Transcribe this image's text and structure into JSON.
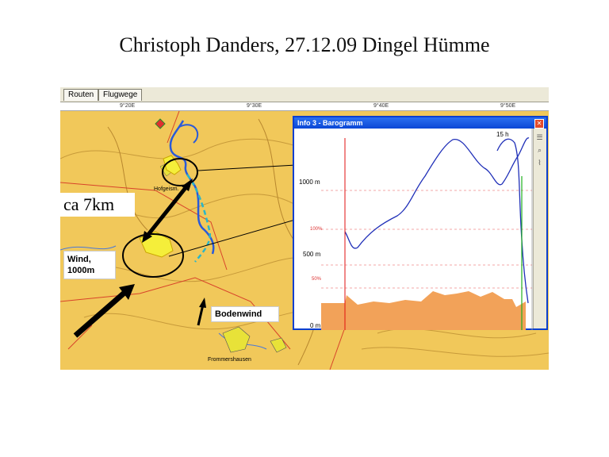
{
  "slide": {
    "title": "Christoph Danders, 27.12.09 Dingel Hümme"
  },
  "tabs": [
    {
      "label": "Routen"
    },
    {
      "label": "Flugwege"
    }
  ],
  "coords": {
    "c1": "9°20E",
    "c2": "9°30E",
    "c3": "9°40E",
    "c4": "9°50E"
  },
  "map_labels": {
    "town_top": "Hofgeism.",
    "town_bottom": "Frommershausen"
  },
  "annotations": {
    "distance": "ca 7km",
    "wind_line1": "Wind,",
    "wind_line2": "1000m",
    "ground_wind": "Bodenwind"
  },
  "barogram": {
    "title": "Info 3 - Barogramm",
    "close_icon": "close-icon",
    "tools": [
      "list-icon",
      "zoom-icon",
      "chart-icon"
    ],
    "y_labels": {
      "top": "1000 m",
      "pct100": "100%",
      "mid": "500 m",
      "pct50": "50%",
      "zero": "0 m"
    },
    "time_label": "15 h",
    "colors": {
      "altitude": "#1f2fb8",
      "fill": "#f2a259",
      "start_line": "#e01010",
      "end_line": "#20b020",
      "grid": "#f08a8a"
    }
  }
}
